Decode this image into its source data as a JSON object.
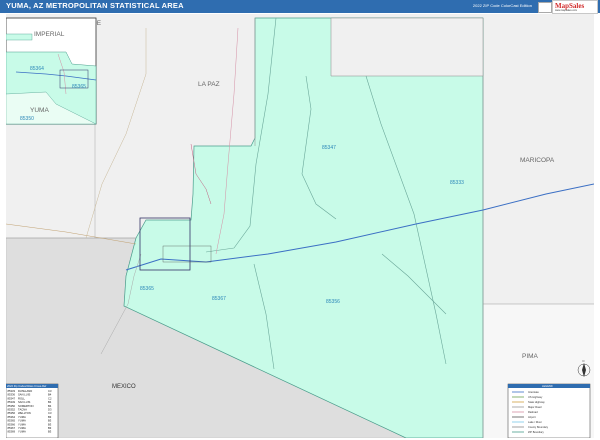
{
  "header": {
    "title": "YUMA, AZ METROPOLITAN STATISTICAL AREA",
    "edition": "2022 ZIP Code ColorCast Edition",
    "logo_main": "MapSales",
    "logo_sub": "www.mapsales.com"
  },
  "colors": {
    "title_bar": "#2f6db0",
    "zip_fill": "#c8fbe8",
    "background": "#f0f0f0",
    "mexico": "#dedede",
    "zip_label": "#2a86b8",
    "highway": "#3b6fc4"
  },
  "map": {
    "counties": [
      "LA PAZ",
      "MARICOPA",
      "PIMA",
      "IMPERIAL",
      "YUMA"
    ],
    "country": "MEXICO",
    "county_partial": "DE",
    "zip_codes": [
      "85347",
      "85333",
      "85356",
      "85367",
      "85365",
      "85364",
      "85350"
    ]
  },
  "inset": {
    "county": "IMPERIAL",
    "zips": [
      "85364",
      "85365",
      "85350"
    ]
  },
  "zip_table": {
    "header": "2022 Zip Codes/Cities Cross-Ref",
    "rows": [
      [
        "85333",
        "DATELAND",
        "C3"
      ],
      [
        "85336",
        "SAN LUIS",
        "B4"
      ],
      [
        "85347",
        "ROLL",
        "C2"
      ],
      [
        "85349",
        "SAN LUIS",
        "B4"
      ],
      [
        "85350",
        "SOMERTON",
        "B4"
      ],
      [
        "85352",
        "TACNA",
        "D3"
      ],
      [
        "85356",
        "WELLTON",
        "C3"
      ],
      [
        "85364",
        "YUMA",
        "B3"
      ],
      [
        "85365",
        "YUMA",
        "B3"
      ],
      [
        "85366",
        "YUMA",
        "B3"
      ],
      [
        "85367",
        "YUMA",
        "B3"
      ],
      [
        "85369",
        "YUMA",
        "B3"
      ]
    ]
  },
  "legend": {
    "title": "LEGEND",
    "items": [
      "Interstate",
      "US Highway",
      "State Highway",
      "Major Road",
      "Railroad",
      "Airport",
      "Lake / River",
      "County Boundary",
      "ZIP Boundary"
    ]
  },
  "compass": "N"
}
